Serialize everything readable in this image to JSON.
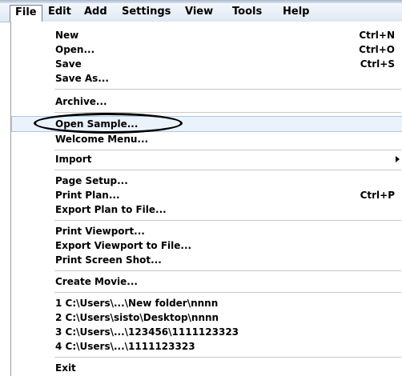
{
  "menubar": {
    "items": [
      "File",
      "Edit",
      "Add",
      "Settings",
      "View",
      "Tools",
      "Help"
    ]
  },
  "file_menu": {
    "new": {
      "label": "New",
      "shortcut": "Ctrl+N"
    },
    "open": {
      "label": "Open...",
      "shortcut": "Ctrl+O"
    },
    "save": {
      "label": "Save",
      "shortcut": "Ctrl+S"
    },
    "save_as": {
      "label": "Save As..."
    },
    "archive": {
      "label": "Archive..."
    },
    "open_sample": {
      "label": "Open Sample..."
    },
    "welcome_menu": {
      "label": "Welcome Menu..."
    },
    "import": {
      "label": "Import"
    },
    "page_setup": {
      "label": "Page Setup..."
    },
    "print_plan": {
      "label": "Print Plan...",
      "shortcut": "Ctrl+P"
    },
    "export_plan": {
      "label": "Export Plan to File..."
    },
    "print_viewport": {
      "label": "Print Viewport..."
    },
    "export_viewport": {
      "label": "Export Viewport to File..."
    },
    "print_screen": {
      "label": "Print Screen Shot..."
    },
    "create_movie": {
      "label": "Create Movie..."
    },
    "recent": [
      "1 C:\\Users\\...\\New folder\\nnnn",
      "2 C:\\Users\\sisto\\Desktop\\nnnn",
      "3 C:\\Users\\...\\123456\\1111123323",
      "4 C:\\Users\\...\\1111123323"
    ],
    "exit": {
      "label": "Exit"
    }
  }
}
